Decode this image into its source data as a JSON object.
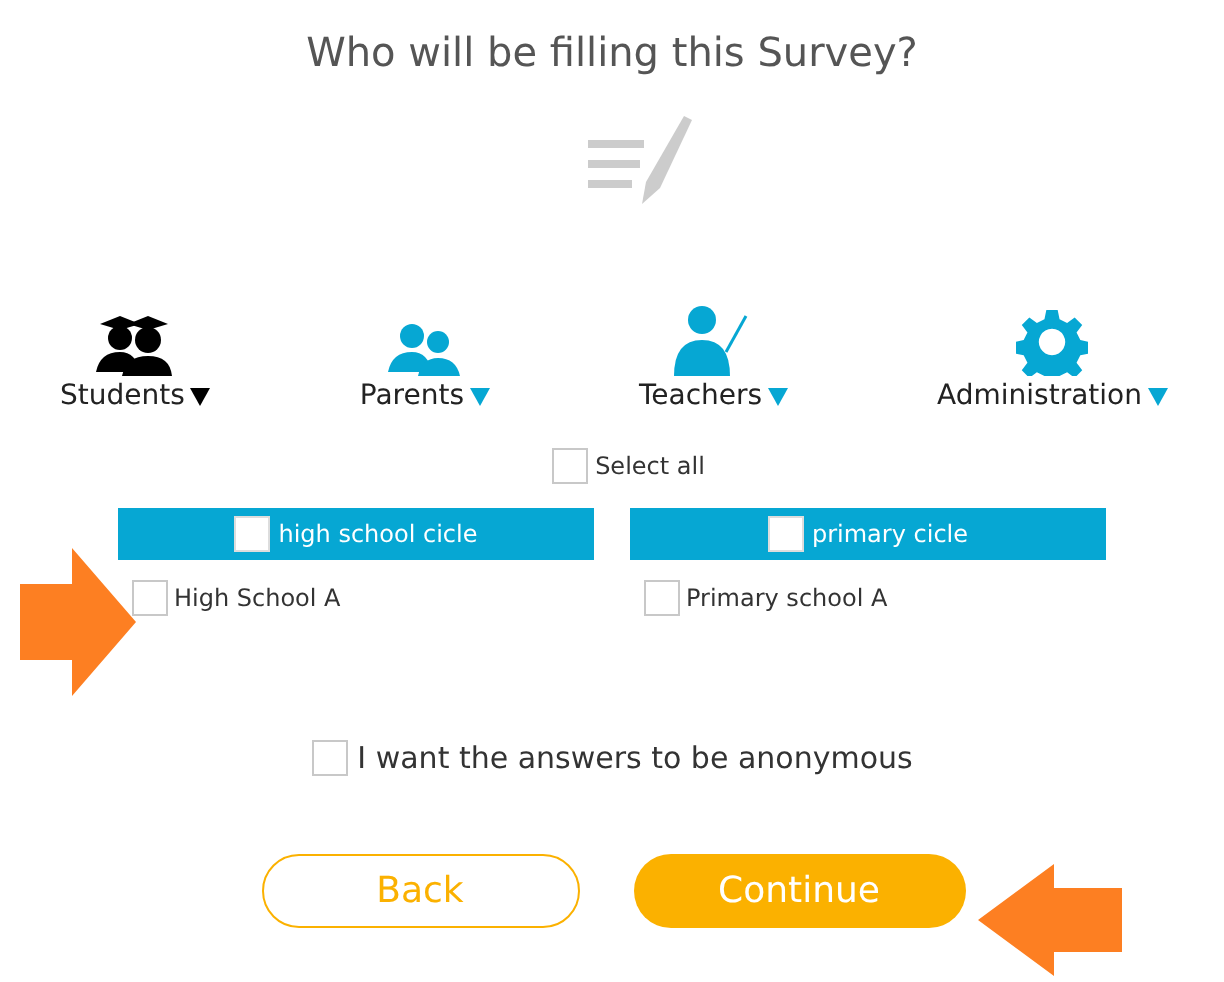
{
  "title": "Who will be filling this Survey?",
  "roles": [
    {
      "label": "Students",
      "kind": "students",
      "selected": true
    },
    {
      "label": "Parents",
      "kind": "parents",
      "selected": false
    },
    {
      "label": "Teachers",
      "kind": "teachers",
      "selected": false
    },
    {
      "label": "Administration",
      "kind": "administration",
      "selected": false
    }
  ],
  "select_all": {
    "label": "Select all",
    "checked": false
  },
  "groups": [
    {
      "label": "high school cicle",
      "checked": false,
      "items": [
        {
          "label": "High School A",
          "checked": false
        }
      ]
    },
    {
      "label": "primary cicle",
      "checked": false,
      "items": [
        {
          "label": "Primary school A",
          "checked": false
        }
      ]
    }
  ],
  "anonymous": {
    "label": "I want the answers to be anonymous",
    "checked": false
  },
  "buttons": [
    {
      "label": "Back",
      "kind": "secondary"
    },
    {
      "label": "Continue",
      "kind": "primary"
    }
  ]
}
